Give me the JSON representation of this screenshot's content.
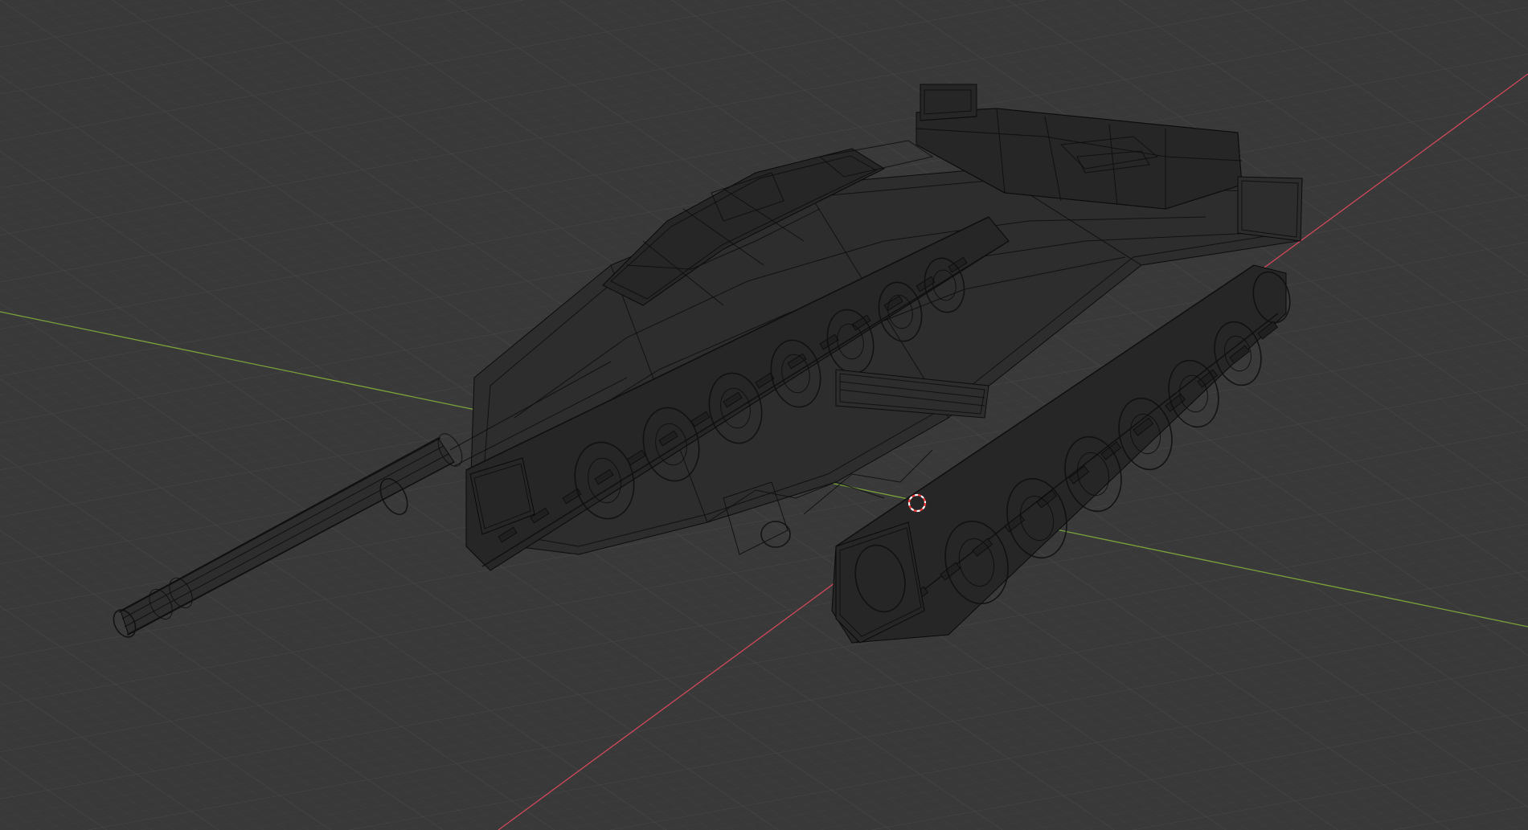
{
  "viewport": {
    "background_color": "#393939",
    "grid_minor_color": "#424242",
    "grid_major_color": "#4a4a4a",
    "x_axis_color": "#d0485b",
    "y_axis_color": "#7aa23a",
    "wire_color": "#0d0d0d",
    "shading_mode": "wireframe"
  },
  "scene": {
    "object": "tank-model",
    "cursor_icon": "3d-cursor-icon",
    "cursor_colors": [
      "#ff3b3b",
      "#ffffff"
    ]
  }
}
